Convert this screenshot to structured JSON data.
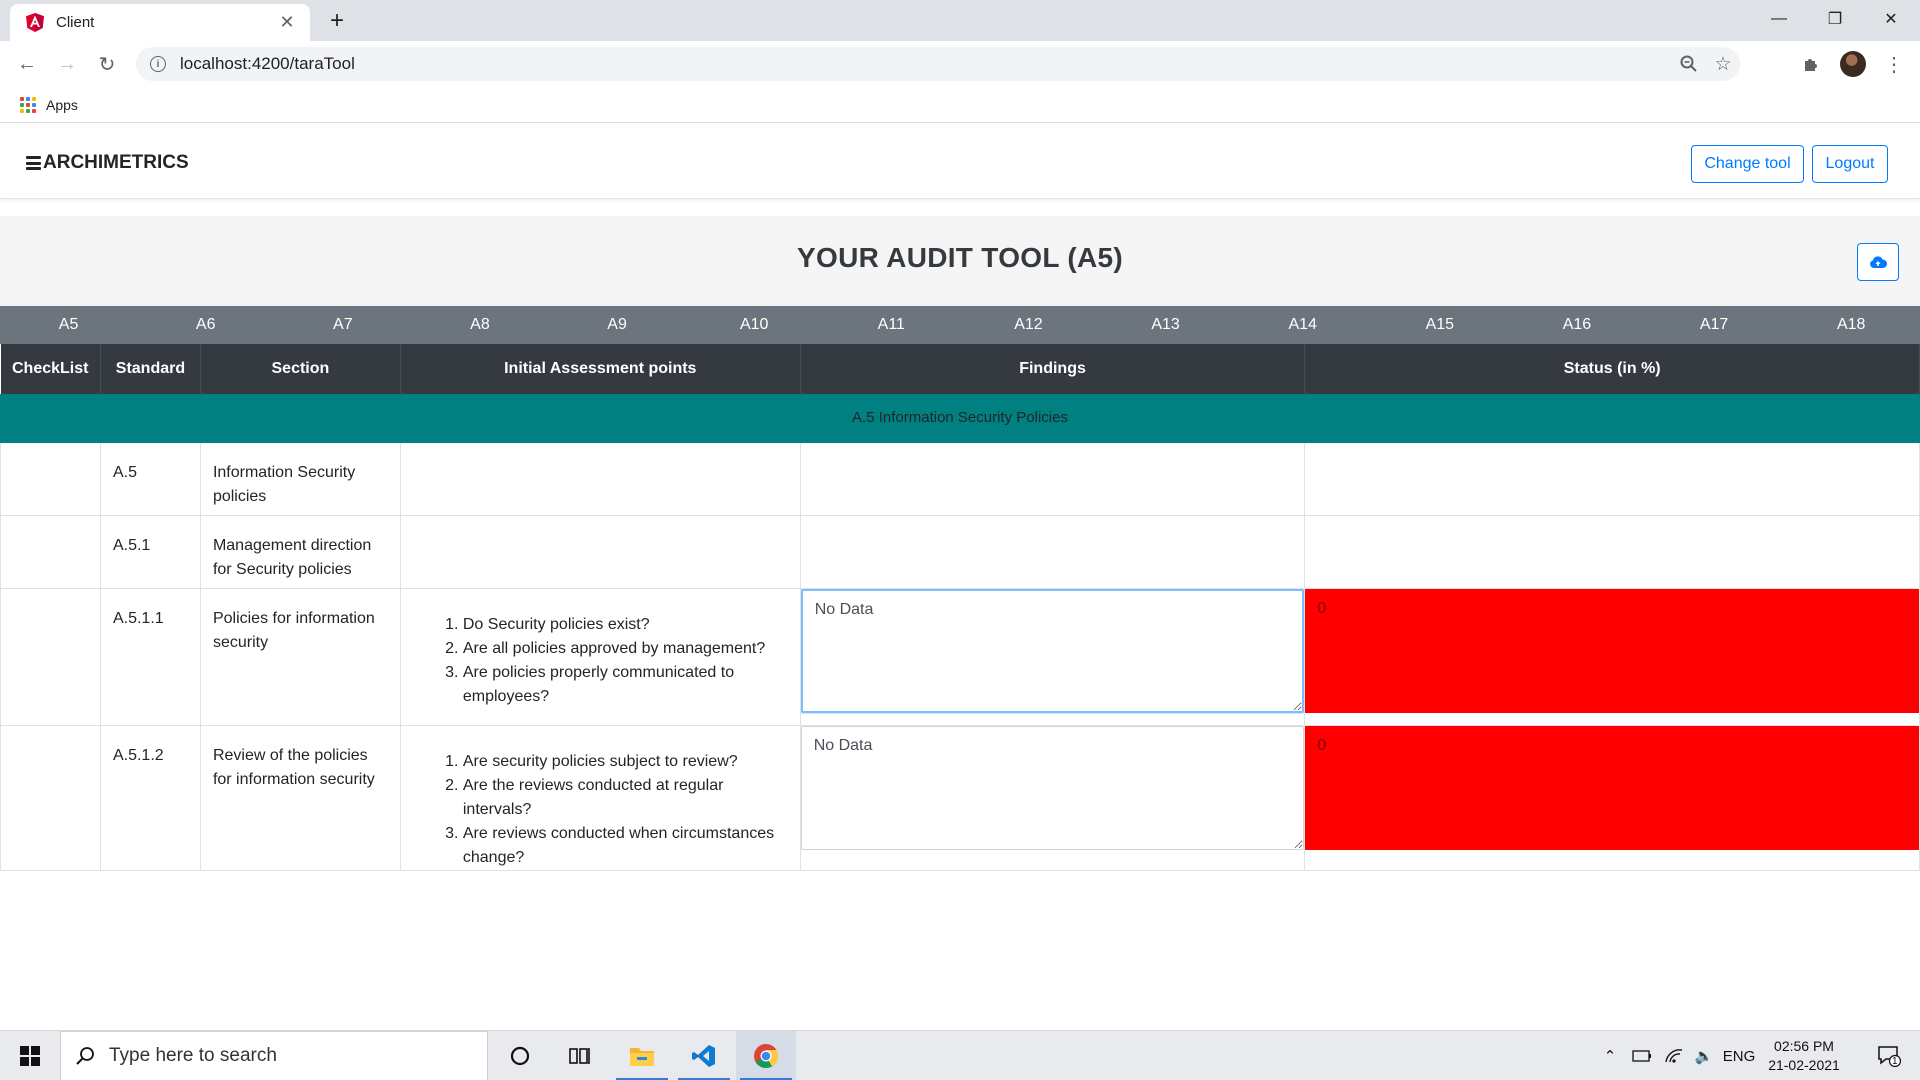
{
  "browser": {
    "tab_title": "Client",
    "url": "localhost:4200/taraTool",
    "bookmark_apps": "Apps"
  },
  "app": {
    "brand": "ARCHIMETRICS",
    "change_tool": "Change tool",
    "logout": "Logout",
    "page_title": "YOUR AUDIT TOOL (A5)"
  },
  "section_tabs": [
    "A5",
    "A6",
    "A7",
    "A8",
    "A9",
    "A10",
    "A11",
    "A12",
    "A13",
    "A14",
    "A15",
    "A16",
    "A17",
    "A18"
  ],
  "table": {
    "headers": [
      "CheckList",
      "Standard",
      "Section",
      "Initial Assessment points",
      "Findings",
      "Status (in %)"
    ],
    "group_title": "A.5 Information Security Policies",
    "rows": [
      {
        "standard": "A.5",
        "section": "Information Security policies"
      },
      {
        "standard": "A.5.1",
        "section": "Management direction for Security policies"
      },
      {
        "standard": "A.5.1.1",
        "section": "Policies for information security",
        "points": [
          "Do Security policies exist?",
          "Are all policies approved by management?",
          "Are policies properly communicated to employees?"
        ],
        "findings": "No Data",
        "status": "0"
      },
      {
        "standard": "A.5.1.2",
        "section": "Review of the policies for information security",
        "points": [
          "Are security policies subject to review?",
          "Are the reviews conducted at regular intervals?",
          "Are reviews conducted when circumstances change?"
        ],
        "findings": "No Data",
        "status": "0"
      }
    ]
  },
  "taskbar": {
    "search_placeholder": "Type here to search",
    "language": "ENG",
    "time": "02:56 PM",
    "date": "21-02-2021",
    "notification_count": "1"
  },
  "colors": {
    "group_row": "#008080",
    "status_low": "#ff0000",
    "primary": "#007bff",
    "header_dark": "#343a40",
    "tabs_gray": "#6c757d"
  }
}
